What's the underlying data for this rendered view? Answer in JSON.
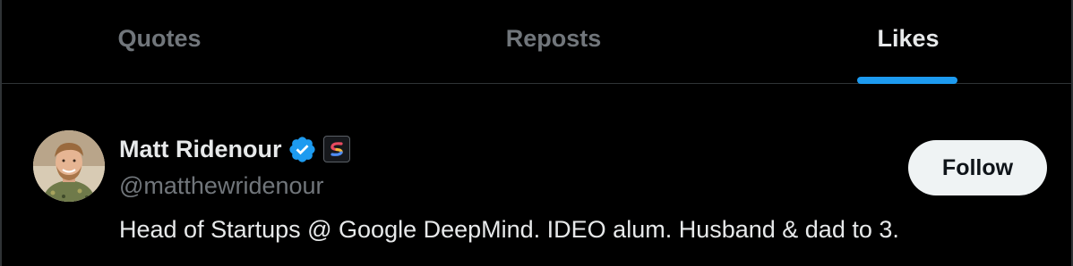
{
  "tabs": [
    {
      "label": "Quotes",
      "active": false
    },
    {
      "label": "Reposts",
      "active": false
    },
    {
      "label": "Likes",
      "active": true
    }
  ],
  "user": {
    "display_name": "Matt Ridenour",
    "handle": "@matthewridenour",
    "bio": "Head of Startups @ Google DeepMind. IDEO alum. Husband & dad to 3.",
    "verified_icon": "verified-badge-icon",
    "affiliate_icon": "affiliate-logo-icon",
    "follow_label": "Follow"
  },
  "colors": {
    "accent": "#1d9bf0",
    "background": "#000000",
    "primary_text": "#e7e9ea",
    "secondary_text": "#71767b",
    "follow_bg": "#eff3f4"
  }
}
